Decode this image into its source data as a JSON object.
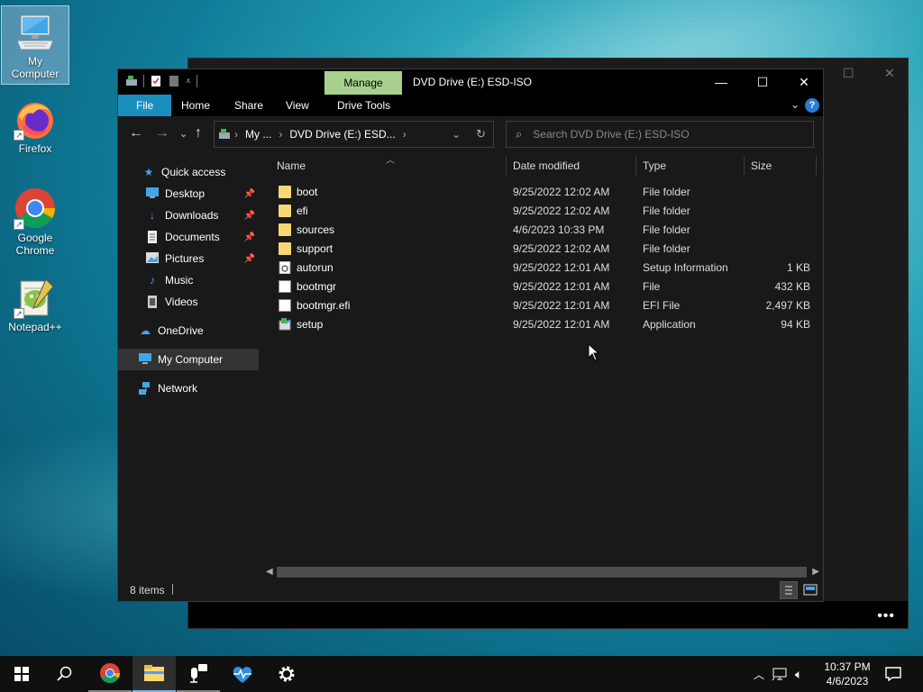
{
  "desktop": {
    "icons": [
      {
        "label": "My Computer",
        "selected": true
      },
      {
        "label": "Firefox"
      },
      {
        "label": "Google\nChrome"
      },
      {
        "label": "Notepad++"
      }
    ]
  },
  "explorer": {
    "title": "DVD Drive (E:) ESD-ISO",
    "contextual_tab": "Manage",
    "ribbon_tabs": [
      "File",
      "Home",
      "Share",
      "View",
      "Drive Tools"
    ],
    "address": {
      "crumbs": [
        "My ...",
        "DVD Drive (E:) ESD..."
      ]
    },
    "search": {
      "placeholder": "Search DVD Drive (E:) ESD-ISO"
    },
    "nav_pane": [
      {
        "label": "Quick access",
        "icon": "star-icon"
      },
      {
        "label": "Desktop",
        "icon": "desktop-icon",
        "pinned": true
      },
      {
        "label": "Downloads",
        "icon": "download-icon",
        "pinned": true
      },
      {
        "label": "Documents",
        "icon": "documents-icon",
        "pinned": true
      },
      {
        "label": "Pictures",
        "icon": "pictures-icon",
        "pinned": true
      },
      {
        "label": "Music",
        "icon": "music-icon"
      },
      {
        "label": "Videos",
        "icon": "videos-icon"
      },
      {
        "label": "OneDrive",
        "icon": "cloud-icon"
      },
      {
        "label": "My Computer",
        "icon": "computer-icon",
        "active": true
      },
      {
        "label": "Network",
        "icon": "network-icon"
      }
    ],
    "columns": [
      "Name",
      "Date modified",
      "Type",
      "Size"
    ],
    "files": [
      {
        "name": "boot",
        "date": "9/25/2022 12:02 AM",
        "type": "File folder",
        "size": "",
        "icon": "folder-icon"
      },
      {
        "name": "efi",
        "date": "9/25/2022 12:02 AM",
        "type": "File folder",
        "size": "",
        "icon": "folder-icon"
      },
      {
        "name": "sources",
        "date": "4/6/2023 10:33 PM",
        "type": "File folder",
        "size": "",
        "icon": "folder-icon"
      },
      {
        "name": "support",
        "date": "9/25/2022 12:02 AM",
        "type": "File folder",
        "size": "",
        "icon": "folder-icon"
      },
      {
        "name": "autorun",
        "date": "9/25/2022 12:01 AM",
        "type": "Setup Information",
        "size": "1 KB",
        "icon": "setup-info-icon"
      },
      {
        "name": "bootmgr",
        "date": "9/25/2022 12:01 AM",
        "type": "File",
        "size": "432 KB",
        "icon": "file-icon"
      },
      {
        "name": "bootmgr.efi",
        "date": "9/25/2022 12:01 AM",
        "type": "EFI File",
        "size": "2,497 KB",
        "icon": "file-icon"
      },
      {
        "name": "setup",
        "date": "9/25/2022 12:01 AM",
        "type": "Application",
        "size": "94 KB",
        "icon": "setup-app-icon"
      }
    ],
    "status": {
      "item_count": "8 items"
    }
  },
  "taskbar": {
    "clock_time": "10:37 PM",
    "clock_date": "4/6/2023"
  },
  "colors": {
    "file_tab": "#1a8fbe",
    "manage_tab": "#a8d08d",
    "folder": "#f8d775"
  }
}
